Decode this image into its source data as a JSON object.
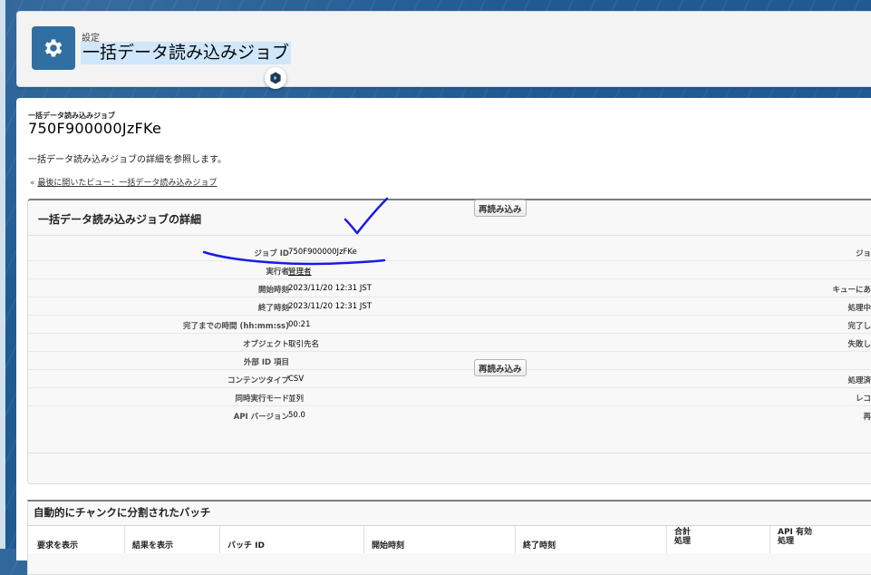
{
  "header": {
    "breadcrumb": "設定",
    "title": "一括データ読み込みジョブ"
  },
  "page": {
    "subtitle": "一括データ読み込みジョブ",
    "record_id": "750F900000JzFKe",
    "description": "一括データ読み込みジョブの詳細を参照します。",
    "back_prefix": "« ",
    "back_link": "最後に開いたビュー：一括データ読み込みジョブ"
  },
  "detail": {
    "section_title": "一括データ読み込みジョブの詳細",
    "reload_label": "再読み込み",
    "fields": [
      {
        "label": "ジョブ ID",
        "value": "750F900000JzFKe",
        "right": "ジョ"
      },
      {
        "label": "実行者",
        "value": "管理者",
        "right": ""
      },
      {
        "label": "開始時刻",
        "value": "2023/11/20 12:31 JST",
        "right": "キューにあ"
      },
      {
        "label": "終了時刻",
        "value": "2023/11/20 12:31 JST",
        "right": "処理中"
      },
      {
        "label": "完了までの時間 (hh:mm:ss)",
        "value": "00:21",
        "right": "完了し"
      },
      {
        "label": "オブジェクト",
        "value": "取引先名",
        "right": "失敗し"
      },
      {
        "label": "外部 ID 項目",
        "value": "",
        "right": ""
      },
      {
        "label": "コンテンツタイプ",
        "value": "CSV",
        "right": "処理済"
      },
      {
        "label": "同時実行モード",
        "value": "並列",
        "right": "レコ"
      },
      {
        "label": "API バージョン",
        "value": "50.0",
        "right": "再"
      }
    ]
  },
  "batches": {
    "title": "自動的にチャンクに分割されたバッチ",
    "columns": [
      "要求を表示",
      "結果を表示",
      "バッチ ID",
      "開始時刻",
      "終了時刻"
    ],
    "col_total": "合計\n処理",
    "col_api": "API 有効\n処理"
  },
  "icons": {
    "header": "gear-icon",
    "fab": "helper-bot-icon"
  },
  "colors": {
    "accent": "#2f6fa1",
    "annotation": "#1a1ae6"
  }
}
